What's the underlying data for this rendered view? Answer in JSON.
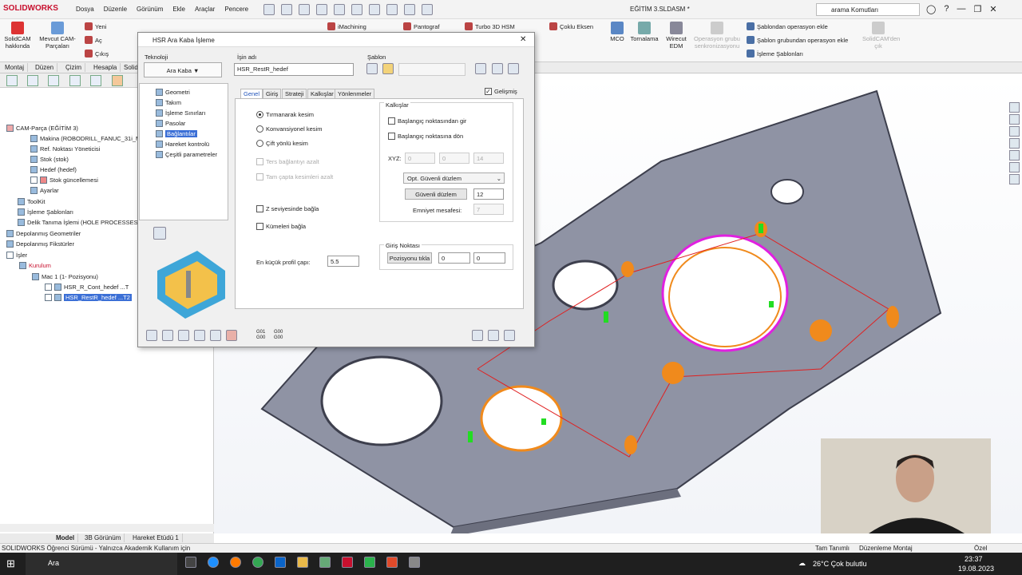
{
  "app": {
    "logo": "SOLIDWORKS",
    "document_title": "EĞİTİM 3.SLDASM *",
    "search_placeholder": "arama Komutları"
  },
  "menu": [
    "Dosya",
    "Düzenle",
    "Görünüm",
    "Ekle",
    "Araçlar",
    "Pencere"
  ],
  "ribbon": {
    "solidcam_about": "SolidCAM hakkında",
    "existing_cam_parts": "Mevcut CAM-Parçaları",
    "new": "Yeni",
    "open": "Aç",
    "exit": "Çıkış",
    "imachining": "iMachining",
    "pantograph": "Pantograf",
    "turbo_hsm": "Turbo 3D HSM",
    "multi_axis": "Çoklu Eksen",
    "mco": "MCO",
    "turning": "Tornalama",
    "wire_edm": "Wirecut EDM",
    "operation_group": "Operasyon grubu senkronizasyonu",
    "template_add": "Şablondan operasyon ekle",
    "template_group_add": "Şablon grubundan operasyon ekle",
    "machining_templates": "İşleme Şablonları",
    "solidcam_exit": "SolidCAM'den çık"
  },
  "command_tabs": [
    "Montaj",
    "Düzen",
    "Çizim",
    "Hesapla",
    "Solid"
  ],
  "tree": {
    "root": "CAM-Parça (EĞİTİM 3)",
    "items": [
      "Makina (ROBODRILL_FANUC_31i_MO",
      "Ref. Noktası Yöneticisi",
      "Stok (stok)",
      "Hedef (hedef)",
      "Stok güncellemesi",
      "Ayarlar",
      "ToolKit",
      "İşleme Şablonları",
      "Delik Tanıma İşlemi (HOLE PROCESSES - SC",
      "Depolanmış Geometriler",
      "Depolanmış Fikstürler",
      "İşler",
      "Kurulum",
      "Mac 1 (1- Pozisyonu)",
      "HSR_R_Cont_hedef ...T",
      "HSR_RestR_hedef ...T2"
    ]
  },
  "bottom_tabs": [
    "Model",
    "3B Görünüm",
    "Hareket Etüdü 1"
  ],
  "status": {
    "left": "SOLIDWORKS Öğrenci Sürümü - Yalnızca Akademik Kullanım için",
    "units": "Tam Tanımlı",
    "mode": "Düzenleme Montaj",
    "custom": "Özel"
  },
  "dialog": {
    "title": "HSR Ara Kaba İşleme",
    "technology_label": "Teknoloji",
    "technology_value": "Ara Kaba",
    "job_name_label": "İşin adı",
    "job_name_value": "HSR_RestR_hedef",
    "template_label": "Şablon",
    "advanced_label": "Gelişmiş",
    "nav_items": [
      "Geometri",
      "Takım",
      "İşleme Sınırları",
      "Pasolar",
      "Bağlantılar",
      "Hareket kontrolü",
      "Çeşitli parametreler"
    ],
    "tabs": [
      "Genel",
      "Giriş",
      "Strateji",
      "Kalkışlar",
      "Yönlenmeler"
    ],
    "options": {
      "climb": "Tırmanarak kesim",
      "conventional": "Konvansiyonel kesim",
      "both": "Çift yönlü kesim",
      "reduce_reverse": "Ters bağlantıyı azalt",
      "reduce_full": "Tam çapta kesimleri azalt",
      "z_level": "Z seviyesinde bağla",
      "clusters": "Kümeleri bağla",
      "min_profile_label": "En küçük profil çapı:",
      "min_profile_value": "5.5"
    },
    "retracts": {
      "title": "Kalkışlar",
      "go_start": "Başlangıç noktasından gir",
      "return_start": "Başlangıç noktasına dön",
      "xyz_label": "XYZ:",
      "x": "0",
      "y": "0",
      "z": "14",
      "opt_plane": "Opt. Güvenli düzlem",
      "safe_plane_btn": "Güvenli düzlem",
      "safe_plane_value": "12",
      "safety_label": "Emniyet mesafesi:",
      "safety_value": "7"
    },
    "entry": {
      "title": "Giriş Noktası",
      "pick_btn": "Pozisyonu tıkla",
      "x": "0",
      "y": "0"
    },
    "bottom_codes": [
      "G01 G00",
      "G00 G00"
    ]
  },
  "taskbar": {
    "search": "Ara",
    "weather": "26°C Çok bulutlu",
    "time": "23:37",
    "date": "19.08.2023"
  },
  "colors": {
    "accent": "#c8102e",
    "selection": "#3b6fd6",
    "part": "#8f93a4",
    "toolpath_orange": "#f08a1c",
    "toolpath_green": "#22dd22",
    "magenta": "#e020e0"
  }
}
